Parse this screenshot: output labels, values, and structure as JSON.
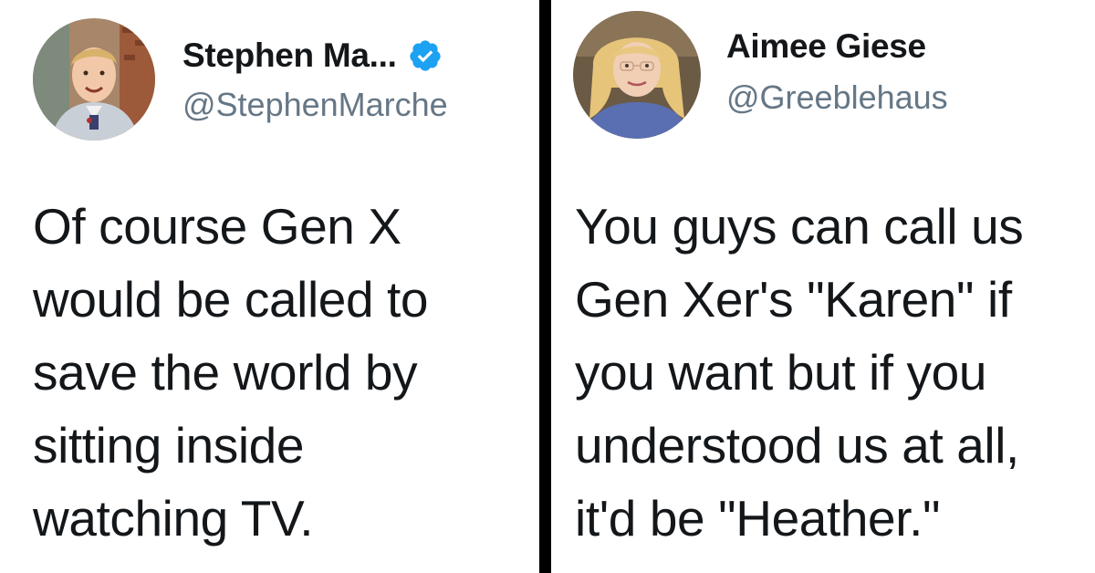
{
  "tweets": [
    {
      "display_name": "Stephen Ma...",
      "handle": "@StephenMarche",
      "verified": true,
      "lines": [
        "Of course Gen X",
        "would be called to",
        "save the world by",
        "sitting inside",
        "watching TV."
      ]
    },
    {
      "display_name": "Aimee Giese",
      "handle": "@Greeblehaus",
      "verified": false,
      "lines": [
        "You guys can call us",
        "Gen Xer's \"Karen\" if",
        "you want but if you",
        "understood us at all,",
        "it'd be \"Heather.\""
      ]
    }
  ],
  "colors": {
    "text": "#14171a",
    "handle": "#657786",
    "verified_badge": "#1da1f2",
    "divider": "#000000"
  },
  "icons": {
    "verified": "verified-badge-icon"
  }
}
